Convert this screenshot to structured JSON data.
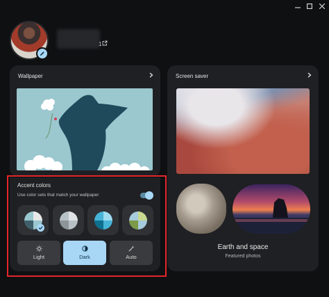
{
  "window": {
    "controls": [
      "minimize",
      "maximize",
      "close"
    ]
  },
  "profile": {
    "name_suffix": "1",
    "edit_icon": "pencil-icon",
    "link_icon": "open-external-icon"
  },
  "wallpaper": {
    "title": "Wallpaper"
  },
  "screensaver": {
    "title": "Screen saver",
    "album_title": "Earth and space",
    "album_subtitle": "Featured photos"
  },
  "accent": {
    "title": "Accent colors",
    "description": "Use color sets that match your wallpaper",
    "toggle_on": true,
    "swatches": [
      {
        "colors": [
          "#9bc7cf",
          "#e8e8e8",
          "#3f5f6a"
        ],
        "selected": true
      },
      {
        "colors": [
          "#b7c1c6",
          "#dfe3e5",
          "#8d9599"
        ],
        "selected": false
      },
      {
        "colors": [
          "#46b4d6",
          "#9fdcf0",
          "#0f6f8e"
        ],
        "selected": false
      },
      {
        "colors": [
          "#a6cbdc",
          "#c9d98f",
          "#7c9a48"
        ],
        "selected": false
      }
    ],
    "modes": [
      {
        "label": "Light",
        "icon": "sun-icon",
        "active": false
      },
      {
        "label": "Dark",
        "icon": "half-moon-icon",
        "active": true
      },
      {
        "label": "Auto",
        "icon": "magic-wand-icon",
        "active": false
      }
    ]
  },
  "colors": {
    "accent": "#a8d7f5",
    "highlight_border": "#e3262b",
    "card_bg": "#1f2023"
  }
}
